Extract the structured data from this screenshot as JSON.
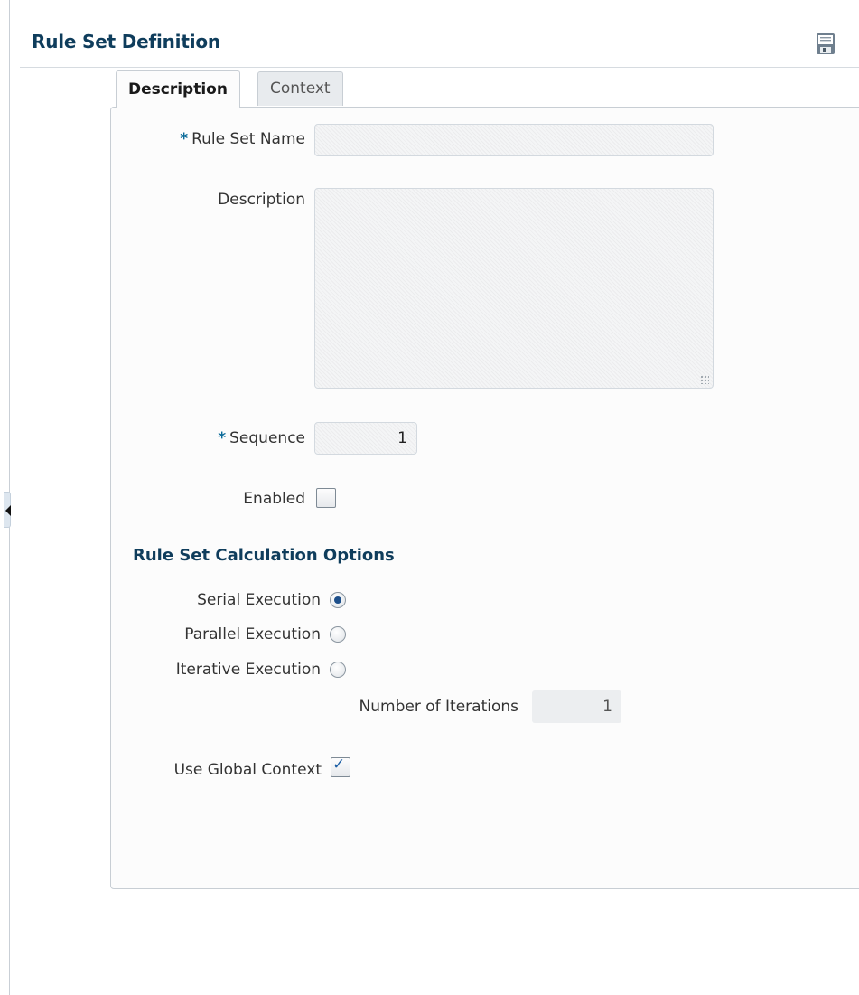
{
  "header": {
    "title": "Rule Set Definition",
    "save_icon": "save-icon"
  },
  "tabs": [
    {
      "label": "Description",
      "active": true
    },
    {
      "label": "Context",
      "active": false
    }
  ],
  "form": {
    "rule_set_name": {
      "label": "Rule Set Name",
      "required_marker": "*",
      "value": ""
    },
    "description": {
      "label": "Description",
      "value": ""
    },
    "sequence": {
      "label": "Sequence",
      "required_marker": "*",
      "value": "1"
    },
    "enabled": {
      "label": "Enabled",
      "checked": false
    }
  },
  "calc_options": {
    "title": "Rule Set Calculation Options",
    "serial": {
      "label": "Serial Execution",
      "selected": true
    },
    "parallel": {
      "label": "Parallel Execution",
      "selected": false
    },
    "iterative": {
      "label": "Iterative Execution",
      "selected": false
    },
    "iterations": {
      "label": "Number of Iterations",
      "value": "1"
    },
    "use_global_context": {
      "label": "Use Global Context",
      "checked": true
    }
  },
  "colors": {
    "heading": "#0f3d5c",
    "required": "#0b6b9a",
    "radio_dot": "#1d4f8a"
  }
}
